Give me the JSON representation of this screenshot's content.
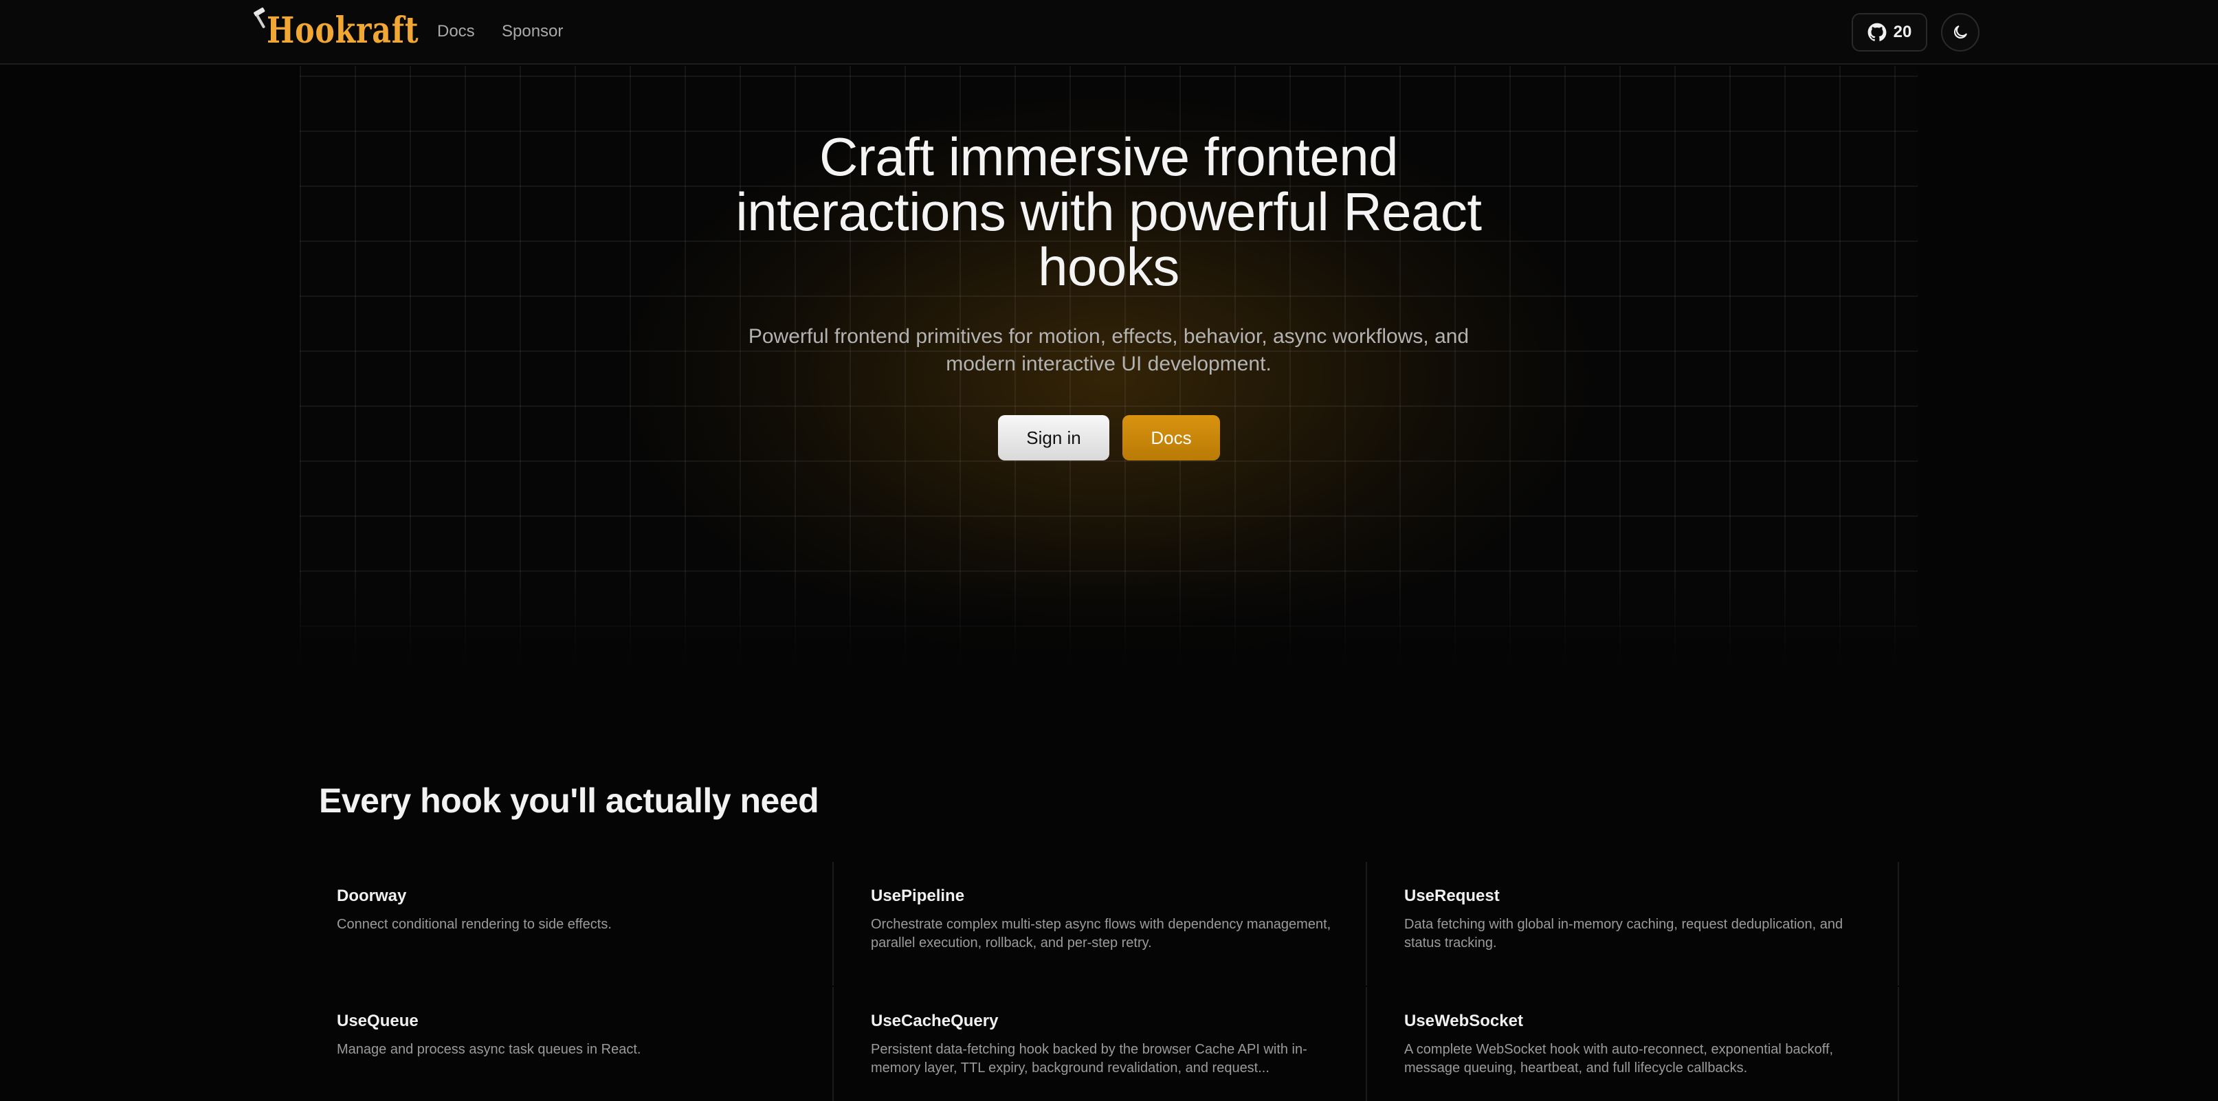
{
  "brand": {
    "logo_text": "Hookraft",
    "accent": "#f0a733"
  },
  "nav": {
    "links": [
      "Docs",
      "Sponsor"
    ],
    "github_stars": "20"
  },
  "hero": {
    "title_lines": [
      "Craft immersive frontend",
      "interactions with powerful React",
      "hooks"
    ],
    "subtitle_lines": [
      "Powerful frontend primitives for motion, effects, behavior, async workflows, and",
      "modern interactive UI development."
    ],
    "primary_button": "Sign in",
    "secondary_button": "Docs",
    "secondary_color": "#c8870a"
  },
  "features": {
    "heading": "Every hook you'll actually need",
    "cards": [
      {
        "title": "Doorway",
        "description": "Connect conditional rendering to side effects."
      },
      {
        "title": "UsePipeline",
        "description": "Orchestrate complex multi-step async flows with dependency management, parallel execution, rollback, and per-step retry."
      },
      {
        "title": "UseRequest",
        "description": "Data fetching with global in-memory caching, request deduplication, and status tracking."
      },
      {
        "title": "UseQueue",
        "description": "Manage and process async task queues in React."
      },
      {
        "title": "UseCacheQuery",
        "description": "Persistent data-fetching hook backed by the browser Cache API with in-memory layer, TTL expiry, background revalidation, and request..."
      },
      {
        "title": "UseWebSocket",
        "description": "A complete WebSocket hook with auto-reconnect, exponential backoff, message queuing, heartbeat, and full lifecycle callbacks."
      }
    ]
  },
  "icons": [
    "hammer-icon",
    "github-icon",
    "moon-icon"
  ]
}
